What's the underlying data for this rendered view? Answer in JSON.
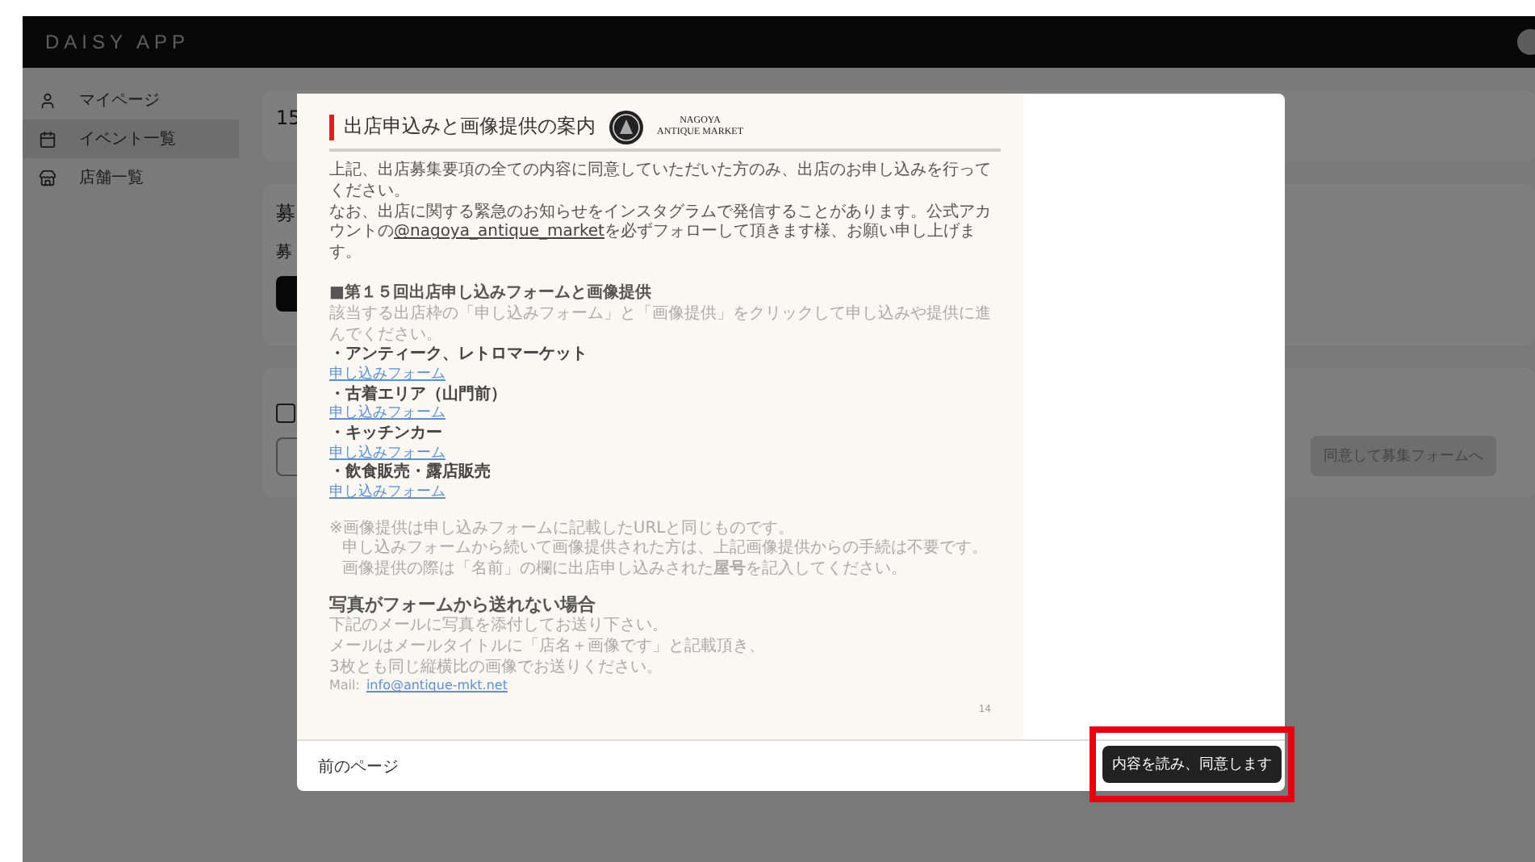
{
  "app": {
    "title": "DAISY APP"
  },
  "sidebar": {
    "items": [
      {
        "kind": "person",
        "label": "マイページ",
        "selected": false
      },
      {
        "kind": "calendar",
        "label": "イベント一覧",
        "selected": true
      },
      {
        "kind": "store",
        "label": "店舗一覧",
        "selected": false
      }
    ]
  },
  "background": {
    "event_number": "15",
    "section_heading": "募",
    "section_label": "募",
    "checkbox_checked": false,
    "agree_button": "同意して募集フォームへ"
  },
  "modal": {
    "document": {
      "title": "出店申込みと画像提供の案内",
      "logo_lines": [
        "NAGOYA",
        "ANTIQUE MARKET"
      ],
      "intro": [
        {
          "text": "上記、出店募集要項の全ての内容に同意していただいた方のみ、出店のお申し込みを行ってください。"
        },
        {
          "text": "なお、出店に関する緊急のお知らせをインスタグラムで発信することがあります。公式アカウントの",
          "link": "@nagoya_antique_market",
          "after": "を必ずフォローして頂きます様、お願い申し上げます。"
        }
      ],
      "forms_heading": "■第１５回出店申し込みフォームと画像提供",
      "forms_description": "該当する出店枠の「申し込みフォーム」と「画像提供」をクリックして申し込みや提供に進んでください。",
      "categories": [
        {
          "name": "・アンティーク、レトロマーケット",
          "link": "申し込みフォーム"
        },
        {
          "name": "・古着エリア（山門前）",
          "link": "申し込みフォーム"
        },
        {
          "name": "・キッチンカー",
          "link": "申し込みフォーム"
        },
        {
          "name": "・飲食販売・露店販売",
          "link": "申し込みフォーム"
        }
      ],
      "notes": [
        "※画像提供は申し込みフォームに記載したURLと同じものです。",
        "申し込みフォームから続いて画像提供された方は、上記画像提供からの手続は不要です。",
        "画像提供の際は「名前」の欄に出店申し込みされた**屋号**を記入してください。"
      ],
      "photo_heading": "写真がフォームから送れない場合",
      "photo_lines": [
        "下記のメールに写真を添付してお送り下さい。",
        "メールはメールタイトルに「店名＋画像です」と記載頂き、",
        "3枚とも同じ縦横比の画像でお送りください。"
      ],
      "mail_label": "Mail:",
      "mail_link": "info@antique-mkt.net",
      "page_number": "14"
    },
    "footer": {
      "back_link": "前のページ",
      "agree_button": "内容を読み、同意します",
      "highlighted": true
    }
  }
}
